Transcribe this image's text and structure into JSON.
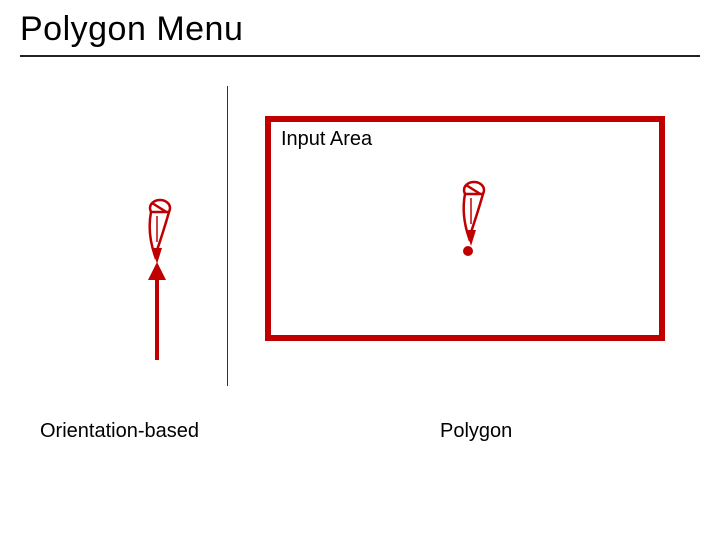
{
  "title": "Polygon Menu",
  "input_area": {
    "label": "Input Area"
  },
  "captions": {
    "left": "Orientation-based",
    "right": "Polygon"
  },
  "colors": {
    "accent": "#c00000"
  }
}
